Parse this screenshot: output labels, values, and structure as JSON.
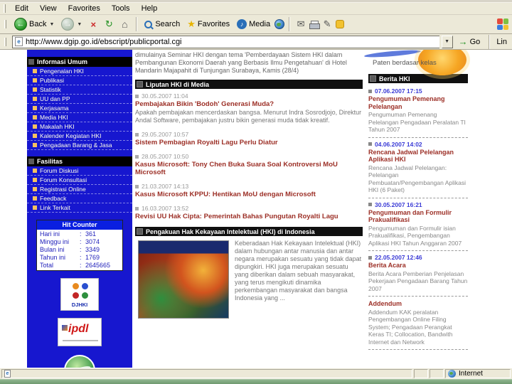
{
  "browser": {
    "menu": [
      "Edit",
      "View",
      "Favorites",
      "Tools",
      "Help"
    ],
    "toolbar": {
      "back": "Back",
      "search": "Search",
      "favorites": "Favorites",
      "media": "Media"
    },
    "icons": {
      "back": "←",
      "forward": "→",
      "stop": "×",
      "refresh": "↻",
      "home": "⌂",
      "star": "★",
      "media_note": "♪",
      "mail": "✉",
      "edit": "✎",
      "dropdown": "▼",
      "go": "→",
      "page": "e"
    },
    "address": {
      "url": "http://www.dgip.go.id/ebscript/publicportal.cgi",
      "go": "Go",
      "links": "Lin"
    },
    "status": {
      "zone": "Internet"
    }
  },
  "page": {
    "banner": {
      "tagline": "Paten berdasar kelas"
    },
    "sidebar": {
      "sections": [
        {
          "title": "Informasi Umum",
          "items": [
            "Pengenalan HKI",
            "Publikasi",
            "Statistik",
            "UU dan PP",
            "Kerjasama",
            "Media HKI",
            "Makalah HKI",
            "Kalender Kegiatan HKI",
            "Pengadaan Barang & Jasa"
          ]
        },
        {
          "title": "Fasilitas",
          "items": [
            "Forum Diskusi",
            "Forum Konsultasi",
            "Registrasi Online",
            "Feedback",
            "Link Terkait"
          ]
        }
      ],
      "hit_counter": {
        "title": "Hit Counter",
        "rows": [
          {
            "label": "Hari ini",
            "value": "361"
          },
          {
            "label": "Minggu ini",
            "value": "3074"
          },
          {
            "label": "Bulan ini",
            "value": "3349"
          },
          {
            "label": "Tahun ini",
            "value": "1769"
          },
          {
            "label": "Total",
            "value": "2645665"
          }
        ]
      },
      "logos": {
        "djhki": "DJHKI",
        "ipdl": "ipdl"
      }
    },
    "main": {
      "intro": "dimulainya Seminar HKI dengan tema 'Pemberdayaan Sistem HKI dalam Pembangunan Ekonomi Daerah yang Berbasis Ilmu Pengetahuan' di Hotel Mandarin Majapahit di Tunjungan Surabaya, Kamis (28/4)",
      "media_section": {
        "title": "Liputan HKI di Media",
        "items": [
          {
            "date": "30.05.2007 11:04",
            "title": "Pembajakan Bikin 'Bodoh' Generasi Muda?",
            "body": "Apakah pembajakan mencerdaskan bangsa. Menurut Indra Sosrodjojo, Direktur Andal Software, pembajakan justru bikin generasi muda tidak kreatif."
          },
          {
            "date": "29.05.2007 10:57",
            "title": "Sistem Pembagian Royalti Lagu Perlu Diatur"
          },
          {
            "date": "28.05.2007 10:50",
            "title": "Kasus Microsoft: Tony Chen Buka Suara Soal Kontroversi MoU Microsoft"
          },
          {
            "date": "21.03.2007 14:13",
            "title": "Kasus Microsoft KPPU: Hentikan MoU dengan Microsoft"
          },
          {
            "date": "16.03.2007 13:52",
            "title": "Revisi UU Hak Cipta: Pemerintah Bahas Pungutan Royalti Lagu"
          }
        ]
      },
      "hki_section": {
        "title": "Pengakuan Hak Kekayaan Intelektual (HKI) di Indonesia",
        "body": "Keberadaan Hak Kekayaan Intelektual (HKI) dalam hubungan antar manusia dan antar negara merupakan sesuatu yang tidak dapat dipungkiri. HKI juga merupakan sesuatu yang diberikan dalam sebuah masyarakat, yang terus mengikuti dinamika perkembangan masyarakat dan bangsa Indonesia yang ..."
      }
    },
    "news": {
      "title": "Berita HKI",
      "items": [
        {
          "date": "07.06.2007 17:15",
          "title": "Pengumuman Pemenang Pelelangan",
          "body": "Pengumuman Pemenang Pelelangan Pengadaan Peralatan TI Tahun 2007"
        },
        {
          "date": "04.06.2007 14:02",
          "title": "Rencana Jadwal Pelelangan Aplikasi HKI",
          "body": "Rencana Jadwal Pelelangan: Pelelangan Pembuatan/Pengembangan Aplikasi HKI (6 Paket)"
        },
        {
          "date": "30.05.2007 16:21",
          "title": "Pengumuman dan Formulir Prakualifikasi",
          "body": "Pengumuman dan Formulir isian Prakualifikasi, Pengembangan Aplikasi HKI Tahun Anggaran 2007"
        },
        {
          "date": "22.05.2007 12:46",
          "title": "Berita Acara",
          "body": "Berita Acara Pemberian Penjelasan Pekerjaan Pengadaan Barang Tahun 2007"
        },
        {
          "title": "Addendum",
          "body": "Addendum KAK peralatan Pengembangan Online Filing System; Pengadaan Perangkat Keras TI; Collocation, Bandwith Internet dan Network"
        }
      ]
    }
  }
}
